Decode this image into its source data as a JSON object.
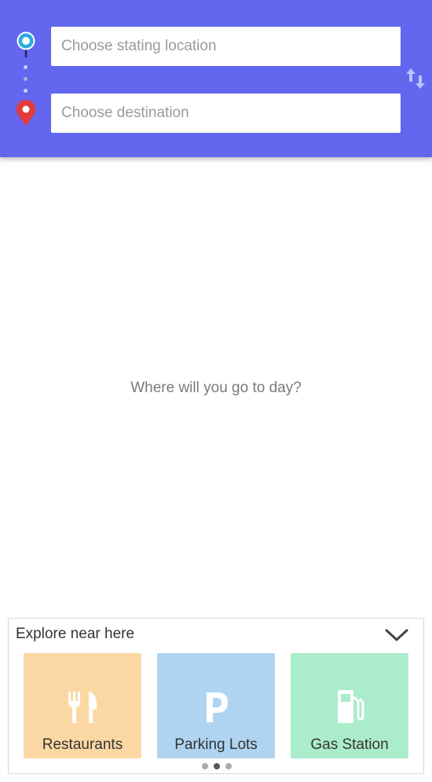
{
  "header": {
    "start_placeholder": "Choose stating location",
    "destination_placeholder": "Choose destination",
    "background_color": "#6366ee"
  },
  "main": {
    "message": "Where will you go to day?"
  },
  "explore": {
    "title": "Explore near here",
    "cards": [
      {
        "label": "Restaurants",
        "icon": "fork-knife-icon",
        "color": "#fbd8a3"
      },
      {
        "label": "Parking Lots",
        "icon": "parking-icon",
        "color": "#afd4f1"
      },
      {
        "label": "Gas Station",
        "icon": "gas-pump-icon",
        "color": "#abecca"
      }
    ],
    "pager": {
      "pages": 3,
      "active_page": 2
    }
  }
}
